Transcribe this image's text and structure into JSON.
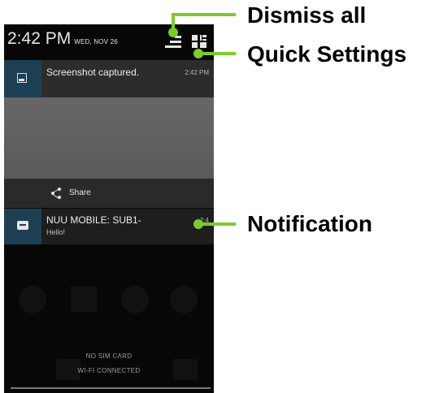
{
  "status_bar": {
    "time": "2:42 PM",
    "date": "WED, NOV 26"
  },
  "notifications": [
    {
      "title": "Screenshot captured.",
      "time": "2:42 PM",
      "icon": "image-icon",
      "action_label": "Share",
      "action_icon": "share-icon"
    },
    {
      "title": "NUU MOBILE: SUB1-",
      "subtitle": "Hello!",
      "time": "2:4",
      "icon": "chat-icon"
    }
  ],
  "lockscreen": {
    "sim_status": "NO SIM CARD",
    "wifi_status": "WI-FI CONNECTED"
  },
  "callouts": {
    "dismiss_all": "Dismiss all",
    "quick_settings": "Quick Settings",
    "notification": "Notification"
  },
  "colors": {
    "accent": "#7ccb2e",
    "icon_box": "#1d3f53",
    "panel": "#070707"
  }
}
